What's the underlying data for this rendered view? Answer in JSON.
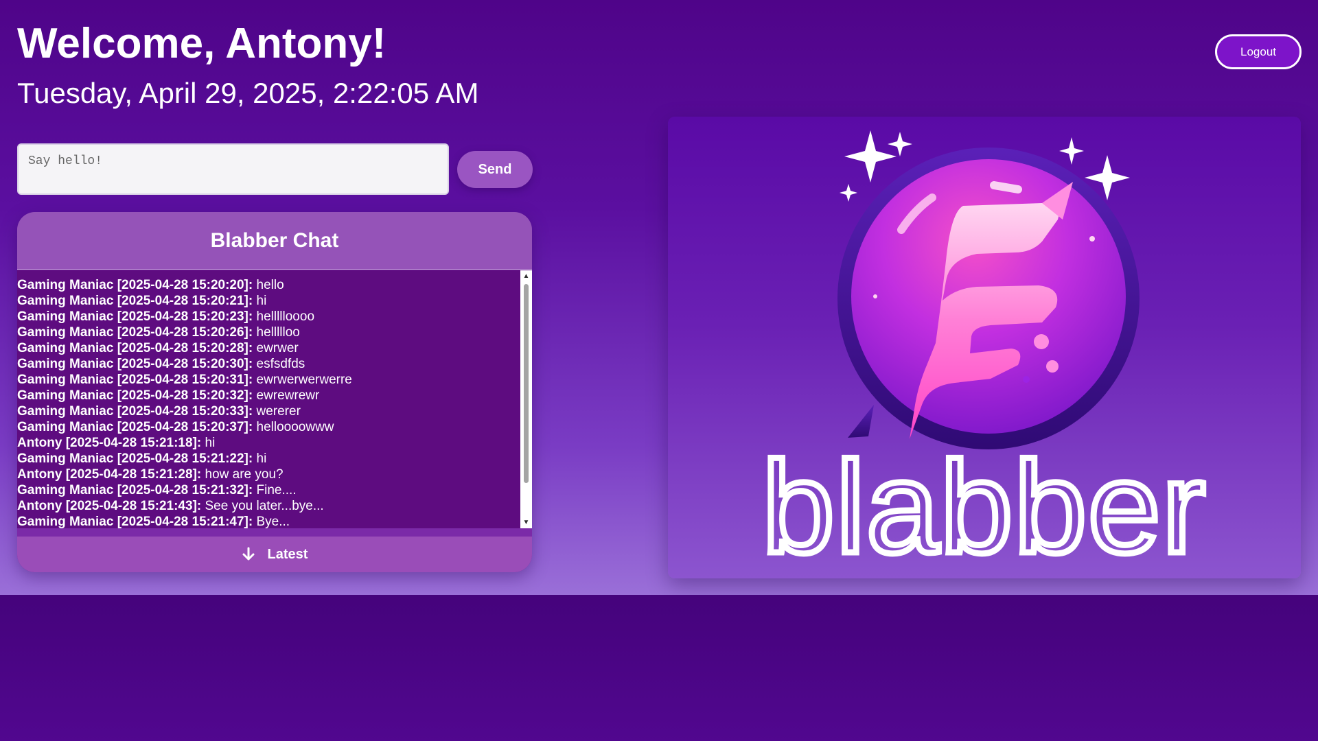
{
  "header": {
    "welcome": "Welcome, Antony!",
    "datetime": "Tuesday, April 29, 2025, 2:22:05 AM",
    "logout_label": "Logout"
  },
  "composer": {
    "placeholder": "Say hello!",
    "send_label": "Send"
  },
  "chat": {
    "title": "Blabber Chat",
    "latest_label": "Latest",
    "messages": [
      {
        "head": "Gaming Maniac [2025-04-28 15:20:20]:",
        "text": " hello"
      },
      {
        "head": "Gaming Maniac [2025-04-28 15:20:21]:",
        "text": " hi"
      },
      {
        "head": "Gaming Maniac [2025-04-28 15:20:23]:",
        "text": " hellllloooo"
      },
      {
        "head": "Gaming Maniac [2025-04-28 15:20:26]:",
        "text": " hellllloo"
      },
      {
        "head": "Gaming Maniac [2025-04-28 15:20:28]:",
        "text": " ewrwer"
      },
      {
        "head": "Gaming Maniac [2025-04-28 15:20:30]:",
        "text": " esfsdfds"
      },
      {
        "head": "Gaming Maniac [2025-04-28 15:20:31]:",
        "text": " ewrwerwerwerre"
      },
      {
        "head": "Gaming Maniac [2025-04-28 15:20:32]:",
        "text": " ewrewrewr"
      },
      {
        "head": "Gaming Maniac [2025-04-28 15:20:33]:",
        "text": " wererer"
      },
      {
        "head": "Gaming Maniac [2025-04-28 15:20:37]:",
        "text": " helloooowww"
      },
      {
        "head": "Antony [2025-04-28 15:21:18]:",
        "text": " hi"
      },
      {
        "head": "Gaming Maniac [2025-04-28 15:21:22]:",
        "text": " hi"
      },
      {
        "head": "Antony [2025-04-28 15:21:28]:",
        "text": " how are you?"
      },
      {
        "head": "Gaming Maniac [2025-04-28 15:21:32]:",
        "text": " Fine...."
      },
      {
        "head": "Antony [2025-04-28 15:21:43]:",
        "text": " See you later...bye..."
      },
      {
        "head": "Gaming Maniac [2025-04-28 15:21:47]:",
        "text": " Bye..."
      }
    ]
  },
  "logo": {
    "brand_name": "blabber"
  },
  "icons": {
    "latest": "arrow-down-icon",
    "scroll_up": "triangle-up-icon",
    "scroll_down": "triangle-down-icon",
    "logo": "blabber-logo-icon"
  },
  "colors": {
    "background_top": "#4f0489",
    "background_bottom": "#9a6fd8",
    "logout_bg": "#7d14c9",
    "send_bg": "#9a55c2",
    "chat_header_bg": "#9553b8",
    "chat_log_bg": "#5e0c80",
    "logo_pink": "#f54fc9",
    "logo_purple": "#9c24e4"
  }
}
